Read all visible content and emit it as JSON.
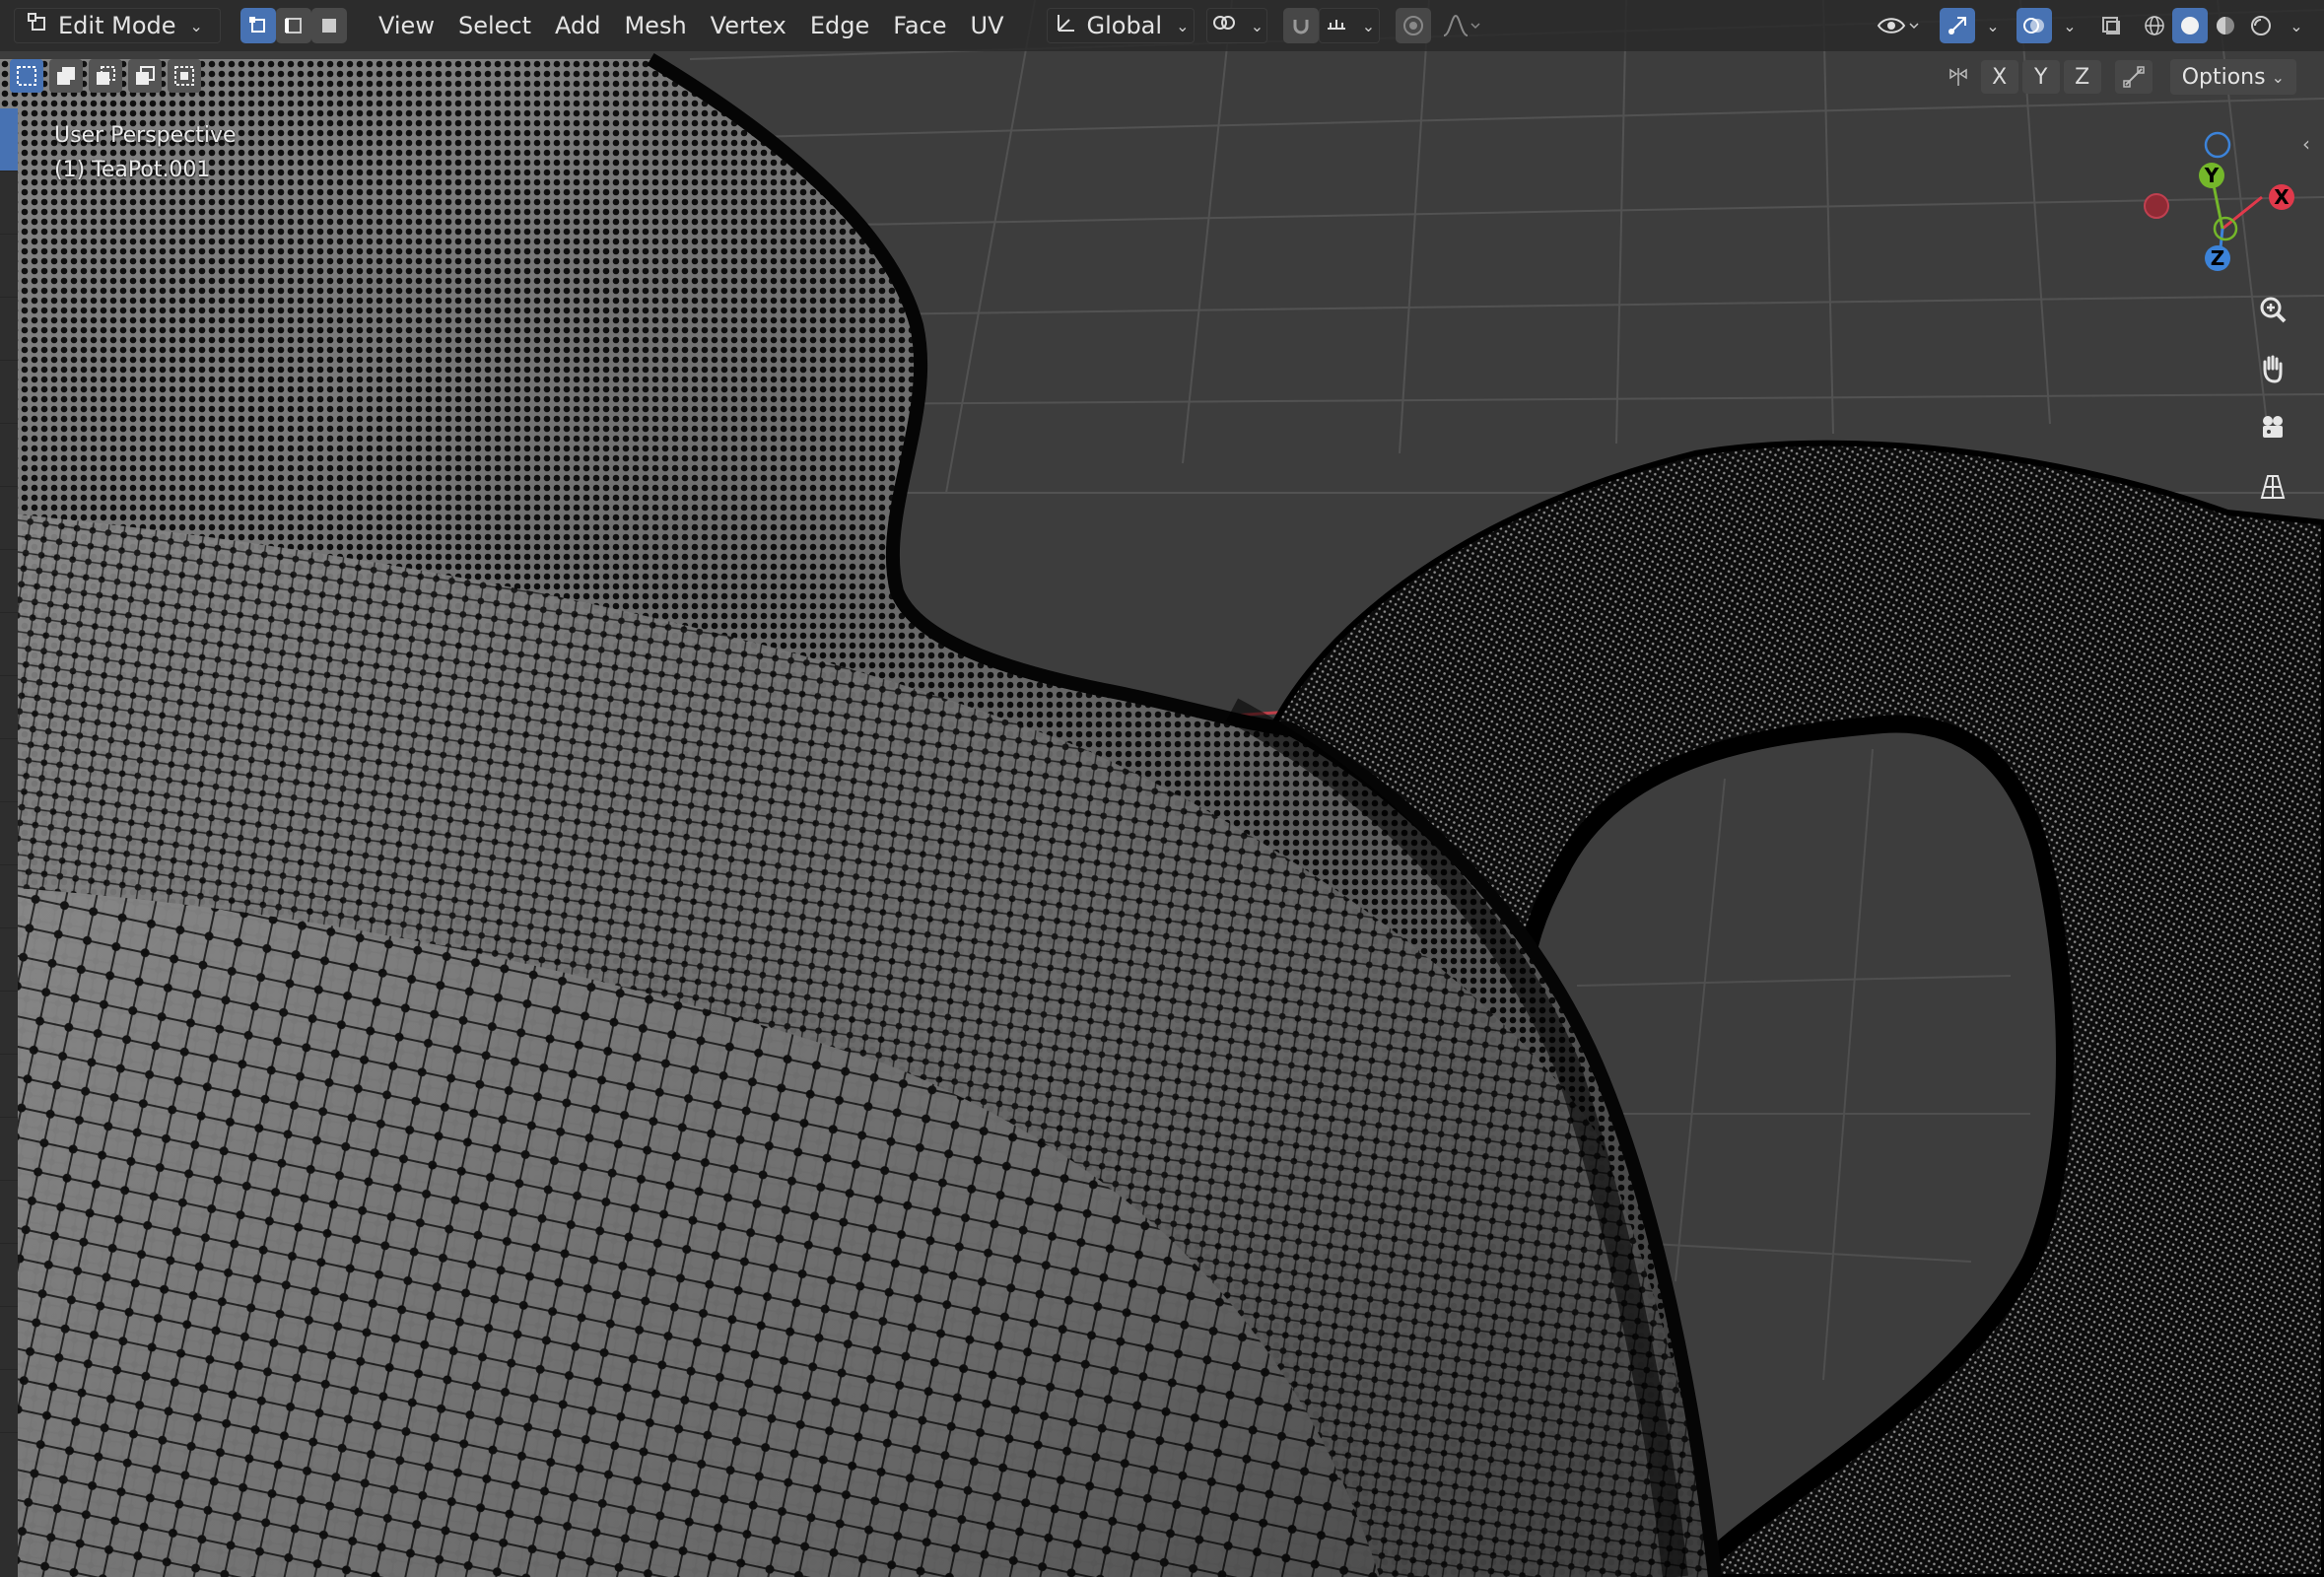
{
  "header": {
    "mode_label": "Edit Mode",
    "menus": [
      "View",
      "Select",
      "Add",
      "Mesh",
      "Vertex",
      "Edge",
      "Face",
      "UV"
    ],
    "transform_orientation": "Global"
  },
  "axis_toggles": [
    "X",
    "Y",
    "Z"
  ],
  "options_label": "Options",
  "viewport": {
    "perspective_label": "User Perspective",
    "object_label": "(1) TeaPot.001"
  },
  "gizmo": {
    "x": "X",
    "y": "Y",
    "z": "Z"
  },
  "colors": {
    "header_bg": "#282828",
    "active_blue": "#4772b3",
    "grid_bg": "#3d3d3d",
    "axis_x": "#e0394b",
    "axis_y": "#74b72a",
    "axis_z": "#3c83d9"
  },
  "icons": {
    "mode": "edit-mode-icon",
    "select_modes": [
      "vertex-select-icon",
      "edge-select-icon",
      "face-select-icon"
    ],
    "transform": "transform-orientation-icon",
    "pivot": "pivot-point-icon",
    "snap": "snap-magnet-icon",
    "snap_target": "snap-increment-icon",
    "proportional": "proportional-edit-icon",
    "falloff": "falloff-curve-icon",
    "visibility": "eye-visibility-icon",
    "gizmos": "gizmo-toggle-icon",
    "overlays": "overlays-icon",
    "xray": "xray-icon",
    "shading": [
      "wireframe-shading-icon",
      "solid-shading-icon",
      "material-shading-icon",
      "rendered-shading-icon"
    ],
    "nav": [
      "zoom-icon",
      "hand-pan-icon",
      "camera-icon",
      "ortho-grid-icon"
    ]
  }
}
